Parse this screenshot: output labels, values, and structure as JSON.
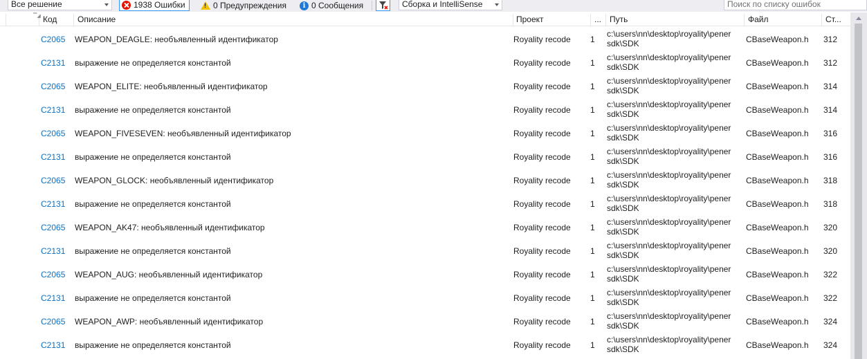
{
  "toolbar": {
    "scope_value": "Все решение",
    "errors_label": "1938 Ошибки",
    "warnings_label": "0 Предупреждения",
    "messages_label": "0 Сообщения",
    "build_value": "Сборка и IntelliSense",
    "search_placeholder": "Поиск по списку ошибок"
  },
  "columns": {
    "code": "Код",
    "description": "Описание",
    "project": "Проект",
    "line_narrow": "...",
    "path": "Путь",
    "file": "Файл",
    "line": "Ст..."
  },
  "rows": [
    {
      "code": "C2065",
      "description": "WEAPON_DEAGLE: необъявленный идентификатор",
      "project": "Royality recode",
      "col": "1",
      "path": "c:\\users\\nn\\desktop\\royality\\pener sdk\\SDK",
      "file": "CBaseWeapon.h",
      "line": "312"
    },
    {
      "code": "C2131",
      "description": "выражение не определяется константой",
      "project": "Royality recode",
      "col": "1",
      "path": "c:\\users\\nn\\desktop\\royality\\pener sdk\\SDK",
      "file": "CBaseWeapon.h",
      "line": "312"
    },
    {
      "code": "C2065",
      "description": "WEAPON_ELITE: необъявленный идентификатор",
      "project": "Royality recode",
      "col": "1",
      "path": "c:\\users\\nn\\desktop\\royality\\pener sdk\\SDK",
      "file": "CBaseWeapon.h",
      "line": "314"
    },
    {
      "code": "C2131",
      "description": "выражение не определяется константой",
      "project": "Royality recode",
      "col": "1",
      "path": "c:\\users\\nn\\desktop\\royality\\pener sdk\\SDK",
      "file": "CBaseWeapon.h",
      "line": "314"
    },
    {
      "code": "C2065",
      "description": "WEAPON_FIVESEVEN: необъявленный идентификатор",
      "project": "Royality recode",
      "col": "1",
      "path": "c:\\users\\nn\\desktop\\royality\\pener sdk\\SDK",
      "file": "CBaseWeapon.h",
      "line": "316"
    },
    {
      "code": "C2131",
      "description": "выражение не определяется константой",
      "project": "Royality recode",
      "col": "1",
      "path": "c:\\users\\nn\\desktop\\royality\\pener sdk\\SDK",
      "file": "CBaseWeapon.h",
      "line": "316"
    },
    {
      "code": "C2065",
      "description": "WEAPON_GLOCK: необъявленный идентификатор",
      "project": "Royality recode",
      "col": "1",
      "path": "c:\\users\\nn\\desktop\\royality\\pener sdk\\SDK",
      "file": "CBaseWeapon.h",
      "line": "318"
    },
    {
      "code": "C2131",
      "description": "выражение не определяется константой",
      "project": "Royality recode",
      "col": "1",
      "path": "c:\\users\\nn\\desktop\\royality\\pener sdk\\SDK",
      "file": "CBaseWeapon.h",
      "line": "318"
    },
    {
      "code": "C2065",
      "description": "WEAPON_AK47: необъявленный идентификатор",
      "project": "Royality recode",
      "col": "1",
      "path": "c:\\users\\nn\\desktop\\royality\\pener sdk\\SDK",
      "file": "CBaseWeapon.h",
      "line": "320"
    },
    {
      "code": "C2131",
      "description": "выражение не определяется константой",
      "project": "Royality recode",
      "col": "1",
      "path": "c:\\users\\nn\\desktop\\royality\\pener sdk\\SDK",
      "file": "CBaseWeapon.h",
      "line": "320"
    },
    {
      "code": "C2065",
      "description": "WEAPON_AUG: необъявленный идентификатор",
      "project": "Royality recode",
      "col": "1",
      "path": "c:\\users\\nn\\desktop\\royality\\pener sdk\\SDK",
      "file": "CBaseWeapon.h",
      "line": "322"
    },
    {
      "code": "C2131",
      "description": "выражение не определяется константой",
      "project": "Royality recode",
      "col": "1",
      "path": "c:\\users\\nn\\desktop\\royality\\pener sdk\\SDK",
      "file": "CBaseWeapon.h",
      "line": "322"
    },
    {
      "code": "C2065",
      "description": "WEAPON_AWP: необъявленный идентификатор",
      "project": "Royality recode",
      "col": "1",
      "path": "c:\\users\\nn\\desktop\\royality\\pener sdk\\SDK",
      "file": "CBaseWeapon.h",
      "line": "324"
    },
    {
      "code": "C2131",
      "description": "выражение не определяется константой",
      "project": "Royality recode",
      "col": "1",
      "path": "c:\\users\\nn\\desktop\\royality\\pener sdk\\SDK",
      "file": "CBaseWeapon.h",
      "line": "324"
    }
  ],
  "colors": {
    "error_red": "#e51400",
    "code_link_blue": "#0e70c0",
    "active_border": "#3399ff"
  },
  "icons": {
    "error": "error-icon",
    "warning": "warning-icon",
    "info": "info-icon",
    "filter": "filter-icon"
  }
}
